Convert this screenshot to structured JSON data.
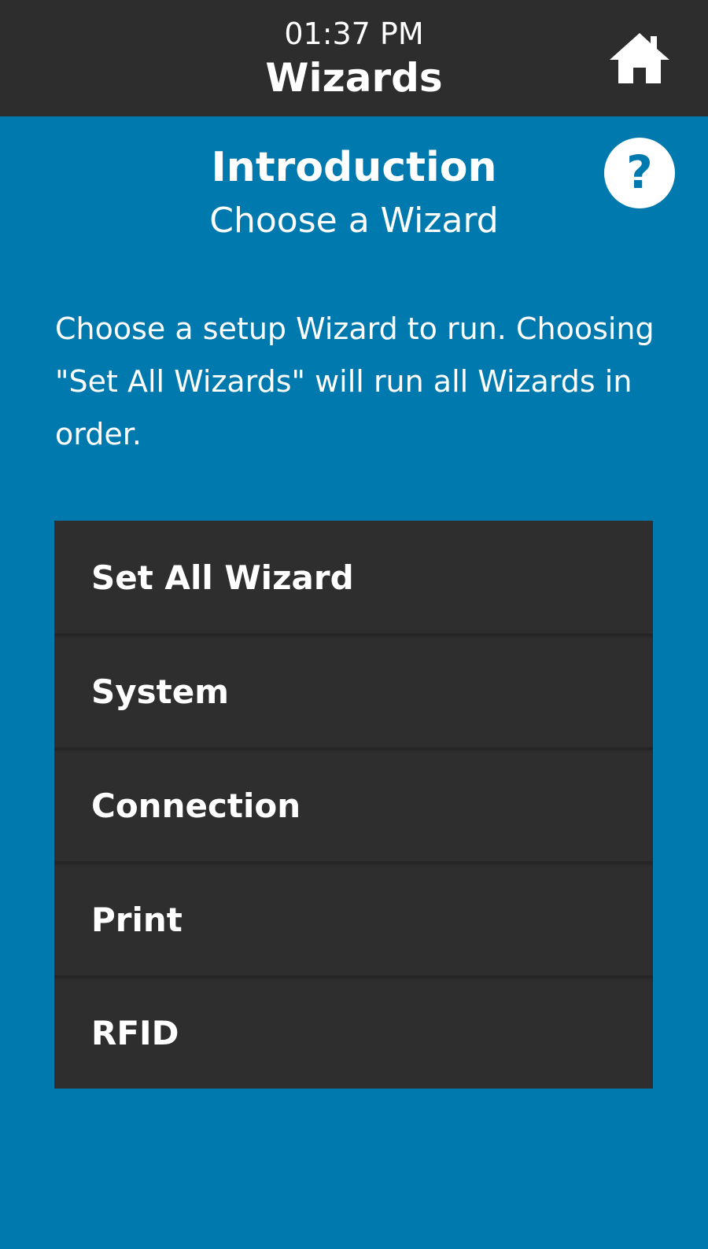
{
  "header": {
    "time": "01:37 PM",
    "title": "Wizards",
    "home_icon": "home-icon"
  },
  "intro": {
    "heading": "Introduction",
    "subheading": "Choose a Wizard",
    "help_icon": "help-icon",
    "description": "Choose a setup Wizard to run. Choosing \"Set All Wizards\" will run all Wizards in order."
  },
  "wizards": [
    {
      "label": "Set All Wizard"
    },
    {
      "label": "System"
    },
    {
      "label": "Connection"
    },
    {
      "label": "Print"
    },
    {
      "label": "RFID"
    }
  ],
  "colors": {
    "background": "#0079ae",
    "bar": "#2d2d2d",
    "text": "#ffffff"
  }
}
